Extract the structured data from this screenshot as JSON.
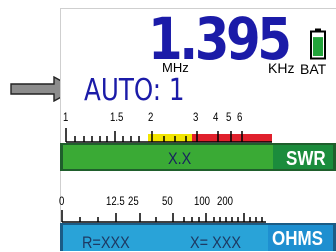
{
  "frequency": {
    "value": "1.395",
    "unit_mhz": "MHz",
    "unit_khz": "KHz"
  },
  "battery": {
    "label": "BAT",
    "icon": "battery-icon",
    "level": 0.9
  },
  "mode": {
    "text": "AUTO: 1",
    "pointer_icon": "arrow-right-icon"
  },
  "swr_meter": {
    "badge": "SWR",
    "ticks": [
      "1",
      "1.5",
      "2",
      "3",
      "4",
      "5",
      "6"
    ],
    "reading": "X.X"
  },
  "ohms_meter": {
    "badge": "OHMS",
    "ticks": [
      "0",
      "12.5",
      "25",
      "50",
      "100",
      "200"
    ],
    "resistance": "R=XXX",
    "reactance": "X= XXX"
  },
  "colors": {
    "display_blue": "#1b1ba8",
    "bar_green": "#3aaa35",
    "scale_yellow": "#f2e400",
    "scale_red": "#e0202c",
    "ohms_blue": "#29a3d8"
  }
}
